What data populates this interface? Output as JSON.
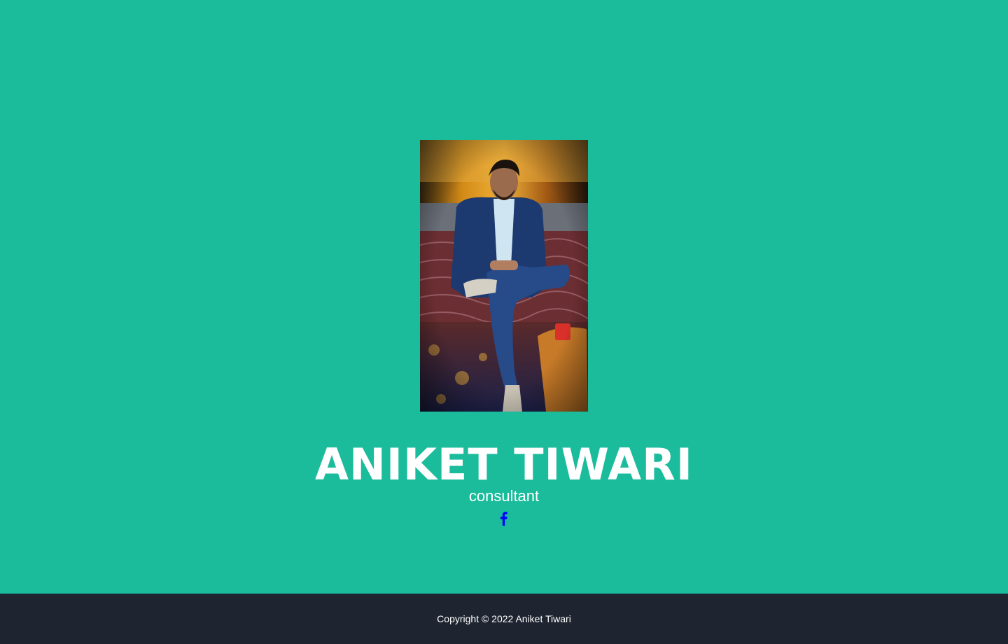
{
  "profile": {
    "name": "ANIKET TIWARI",
    "role": "consultant",
    "photo_icon": "profile-photo"
  },
  "social": {
    "facebook_icon": "facebook-icon",
    "facebook_color": "#0000ff"
  },
  "footer": {
    "copyright": "Copyright © 2022 Aniket Tiwari"
  },
  "colors": {
    "accent": "#1abc9c",
    "footer_bg": "#1e2430",
    "text": "#ffffff"
  }
}
